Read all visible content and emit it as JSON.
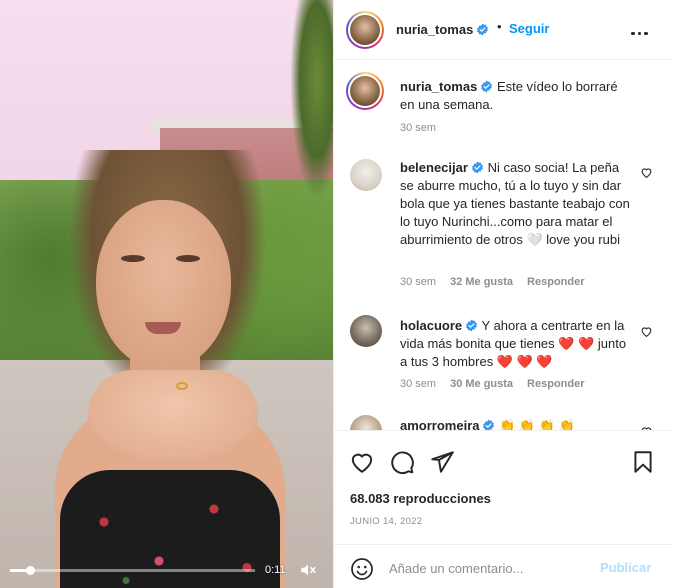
{
  "video": {
    "time_label": "0:11",
    "progress": 0.08,
    "muted": true
  },
  "header": {
    "username": "nuria_tomas",
    "separator": "•",
    "follow_label": "Seguir"
  },
  "caption": {
    "username": "nuria_tomas",
    "text": "Este vídeo lo borraré en una semana.",
    "age": "30 sem"
  },
  "comments": [
    {
      "username": "belenecijar",
      "text": "Ni caso socia! La peña se aburre mucho, tú a lo tuyo y sin dar bola que ya tienes bastante teabajo con lo tuyo Nurinchi...como para matar el aburrimiento de otros 🤍 love you rubi",
      "age": "30 sem",
      "likes": "32 Me gusta",
      "reply": "Responder"
    },
    {
      "username": "holacuore",
      "text": "Y ahora a centrarte en la vida más bonita que tienes ❤️ ❤️ junto a tus 3 hombres ❤️ ❤️ ❤️",
      "age": "30 sem",
      "likes": "30 Me gusta",
      "reply": "Responder"
    },
    {
      "username": "amorromeira",
      "text": "👏 👏 👏 👏"
    }
  ],
  "stats": {
    "views": "68.083 reproducciones",
    "date": "JUNIO 14, 2022"
  },
  "composer": {
    "placeholder": "Añade un comentario...",
    "publish_label": "Publicar"
  },
  "icons": {
    "like": "heart-icon",
    "comment": "comment-icon",
    "share": "share-icon",
    "save": "bookmark-icon",
    "emoji": "emoji-icon",
    "more": "more-options-icon",
    "verified": "verified-badge-icon",
    "mute": "muted-speaker-icon"
  },
  "colors": {
    "link_blue": "#0095f6",
    "publish_disabled": "#b2dffc",
    "verified_blue": "#3897f0",
    "heart_red": "#ed4956"
  }
}
